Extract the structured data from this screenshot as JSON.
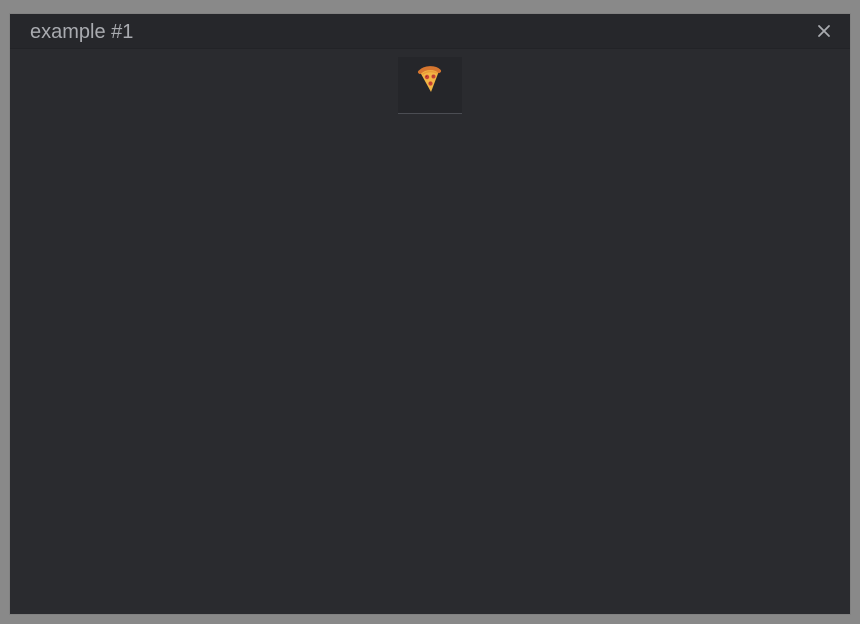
{
  "dialog": {
    "title": "example #1",
    "close_icon": "close-icon"
  },
  "tabs": [
    {
      "icon": "pizza-slice-icon",
      "selected": true
    }
  ],
  "colors": {
    "backdrop": "#898989",
    "modal_background": "#2a2b2f",
    "header_background": "#26272b",
    "title_text": "#a9abb0",
    "tab_underline": "#4b4d53"
  }
}
